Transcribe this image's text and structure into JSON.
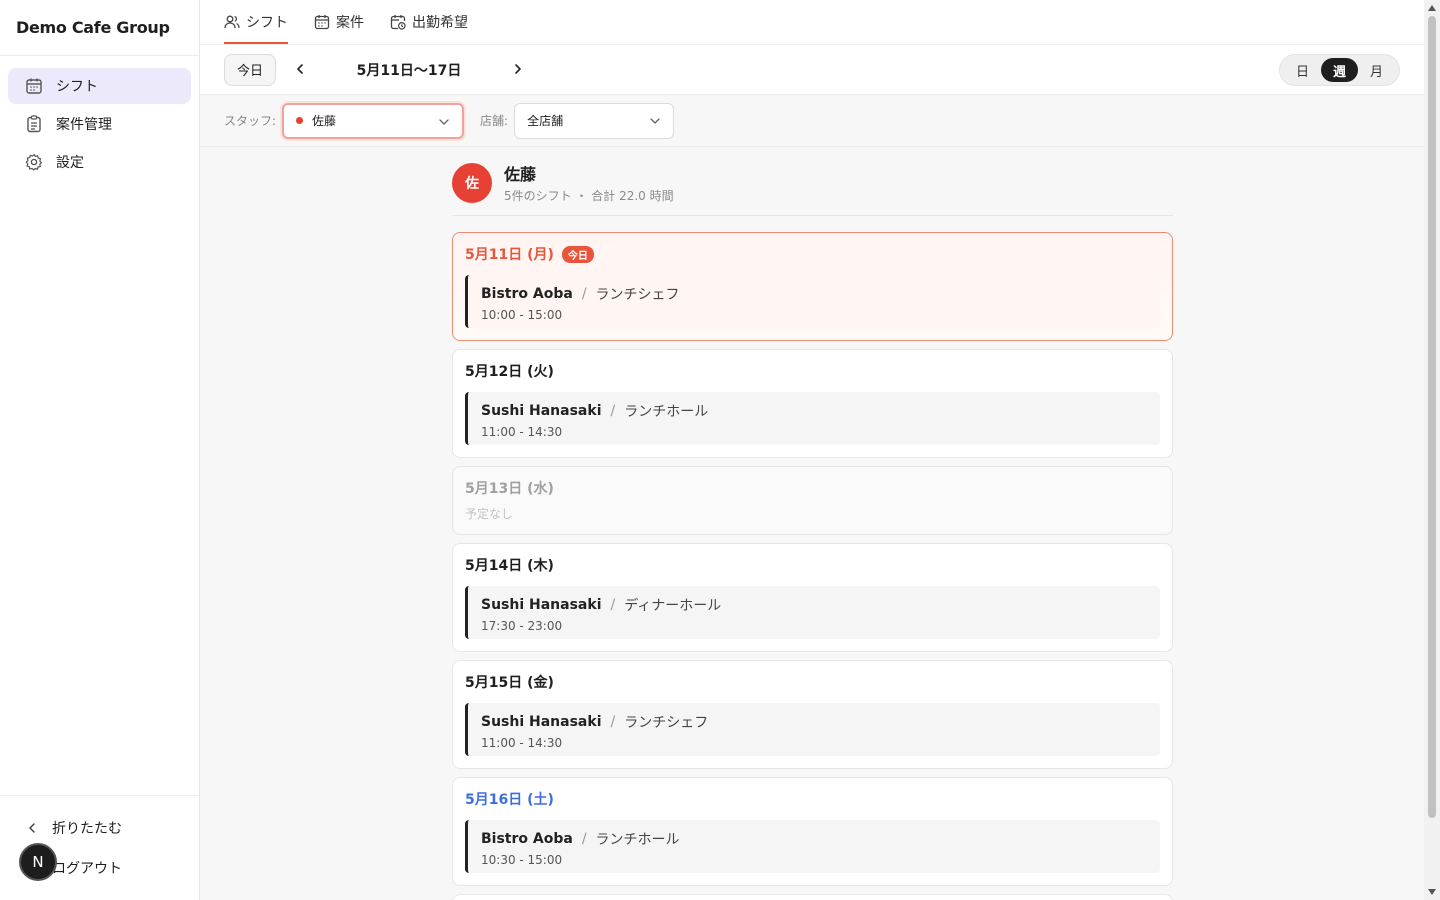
{
  "app": {
    "brand": "Demo Cafe Group"
  },
  "sidebar": {
    "items": [
      {
        "label": "シフト",
        "icon": "calendar-icon",
        "active": true
      },
      {
        "label": "案件管理",
        "icon": "clipboard-icon"
      },
      {
        "label": "設定",
        "icon": "gear-icon"
      }
    ],
    "collapse_label": "折りたたむ",
    "logout_label": "ログアウト",
    "avatar_initial": "N"
  },
  "tabs": [
    {
      "label": "シフト",
      "icon": "users-icon",
      "active": true
    },
    {
      "label": "案件",
      "icon": "calendar-icon"
    },
    {
      "label": "出勤希望",
      "icon": "calendar-clock-icon"
    }
  ],
  "toolbar": {
    "today_label": "今日",
    "range_label": "5月11日〜17日",
    "view_options": [
      "日",
      "週",
      "月"
    ],
    "active_view": "週"
  },
  "filters": {
    "staff_label": "スタッフ:",
    "staff_value": "佐藤",
    "store_label": "店舗:",
    "store_value": "全店舗"
  },
  "staff": {
    "initial": "佐",
    "name": "佐藤",
    "summary": "5件のシフト ・ 合計 22.0 時間",
    "color": "#e74034"
  },
  "days": [
    {
      "date": "5月11日 (月)",
      "today_badge": "今日",
      "shifts": [
        {
          "store": "Bistro Aoba",
          "sep": "/",
          "role": "ランチシェフ",
          "time": "10:00 - 15:00"
        }
      ]
    },
    {
      "date": "5月12日 (火)",
      "shifts": [
        {
          "store": "Sushi Hanasaki",
          "sep": "/",
          "role": "ランチホール",
          "time": "11:00 - 14:30"
        }
      ]
    },
    {
      "date": "5月13日 (水)",
      "empty_label": "予定なし"
    },
    {
      "date": "5月14日 (木)",
      "shifts": [
        {
          "store": "Sushi Hanasaki",
          "sep": "/",
          "role": "ディナーホール",
          "time": "17:30 - 23:00"
        }
      ]
    },
    {
      "date": "5月15日 (金)",
      "shifts": [
        {
          "store": "Sushi Hanasaki",
          "sep": "/",
          "role": "ランチシェフ",
          "time": "11:00 - 14:30"
        }
      ]
    },
    {
      "date": "5月16日 (土)",
      "shifts": [
        {
          "store": "Bistro Aoba",
          "sep": "/",
          "role": "ランチホール",
          "time": "10:30 - 15:00"
        }
      ]
    }
  ],
  "colors": {
    "accent": "#e8553a",
    "saturday": "#3b6fe0",
    "active_nav": "#ece9fb"
  }
}
